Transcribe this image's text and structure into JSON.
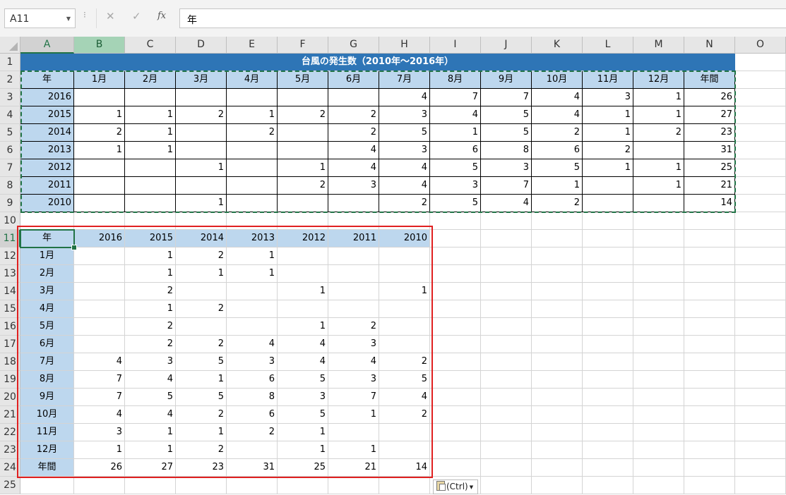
{
  "formula_bar": {
    "name_box": "A11",
    "cancel_icon": "✕",
    "enter_icon": "✓",
    "fx_label": "fx",
    "content": "年"
  },
  "columns": [
    "A",
    "B",
    "C",
    "D",
    "E",
    "F",
    "G",
    "H",
    "I",
    "J",
    "K",
    "L",
    "M",
    "N",
    "O"
  ],
  "rows": [
    "1",
    "2",
    "3",
    "4",
    "5",
    "6",
    "7",
    "8",
    "9",
    "10",
    "11",
    "12",
    "13",
    "14",
    "15",
    "16",
    "17",
    "18",
    "19",
    "20",
    "21",
    "22",
    "23",
    "24",
    "25"
  ],
  "source_table": {
    "title": "台風の発生数（2010年～2016年）",
    "header": [
      "年",
      "1月",
      "2月",
      "3月",
      "4月",
      "5月",
      "6月",
      "7月",
      "8月",
      "9月",
      "10月",
      "11月",
      "12月",
      "年間"
    ],
    "rows": [
      [
        "2016",
        "",
        "",
        "",
        "",
        "",
        "",
        "4",
        "7",
        "7",
        "4",
        "3",
        "1",
        "26"
      ],
      [
        "2015",
        "1",
        "1",
        "2",
        "1",
        "2",
        "2",
        "3",
        "4",
        "5",
        "4",
        "1",
        "1",
        "27"
      ],
      [
        "2014",
        "2",
        "1",
        "",
        "2",
        "",
        "2",
        "5",
        "1",
        "5",
        "2",
        "1",
        "2",
        "23"
      ],
      [
        "2013",
        "1",
        "1",
        "",
        "",
        "",
        "4",
        "3",
        "6",
        "8",
        "6",
        "2",
        "",
        "31"
      ],
      [
        "2012",
        "",
        "",
        "1",
        "",
        "1",
        "4",
        "4",
        "5",
        "3",
        "5",
        "1",
        "1",
        "25"
      ],
      [
        "2011",
        "",
        "",
        "",
        "",
        "2",
        "3",
        "4",
        "3",
        "7",
        "1",
        "",
        "1",
        "21"
      ],
      [
        "2010",
        "",
        "",
        "1",
        "",
        "",
        "",
        "2",
        "5",
        "4",
        "2",
        "",
        "",
        "14"
      ]
    ]
  },
  "transposed_table": {
    "header": [
      "年",
      "2016",
      "2015",
      "2014",
      "2013",
      "2012",
      "2011",
      "2010"
    ],
    "rows": [
      [
        "1月",
        "",
        "1",
        "2",
        "1",
        "",
        "",
        ""
      ],
      [
        "2月",
        "",
        "1",
        "1",
        "1",
        "",
        "",
        ""
      ],
      [
        "3月",
        "",
        "2",
        "",
        "",
        "1",
        "",
        "1"
      ],
      [
        "4月",
        "",
        "1",
        "2",
        "",
        "",
        "",
        ""
      ],
      [
        "5月",
        "",
        "2",
        "",
        "",
        "1",
        "2",
        ""
      ],
      [
        "6月",
        "",
        "2",
        "2",
        "4",
        "4",
        "3",
        ""
      ],
      [
        "7月",
        "4",
        "3",
        "5",
        "3",
        "4",
        "4",
        "2"
      ],
      [
        "8月",
        "7",
        "4",
        "1",
        "6",
        "5",
        "3",
        "5"
      ],
      [
        "9月",
        "7",
        "5",
        "5",
        "8",
        "3",
        "7",
        "4"
      ],
      [
        "10月",
        "4",
        "4",
        "2",
        "6",
        "5",
        "1",
        "2"
      ],
      [
        "11月",
        "3",
        "1",
        "1",
        "2",
        "1",
        "",
        ""
      ],
      [
        "12月",
        "1",
        "1",
        "2",
        "",
        "1",
        "1",
        ""
      ],
      [
        "年間",
        "26",
        "27",
        "23",
        "31",
        "25",
        "21",
        "14"
      ]
    ]
  },
  "paste_options": {
    "label": "(Ctrl)",
    "icon": "clipboard-icon"
  },
  "colors": {
    "title_fill": "#2e75b6",
    "header_fill": "#bdd7ee",
    "selection": "#217346",
    "highlight_box": "#e02020"
  }
}
